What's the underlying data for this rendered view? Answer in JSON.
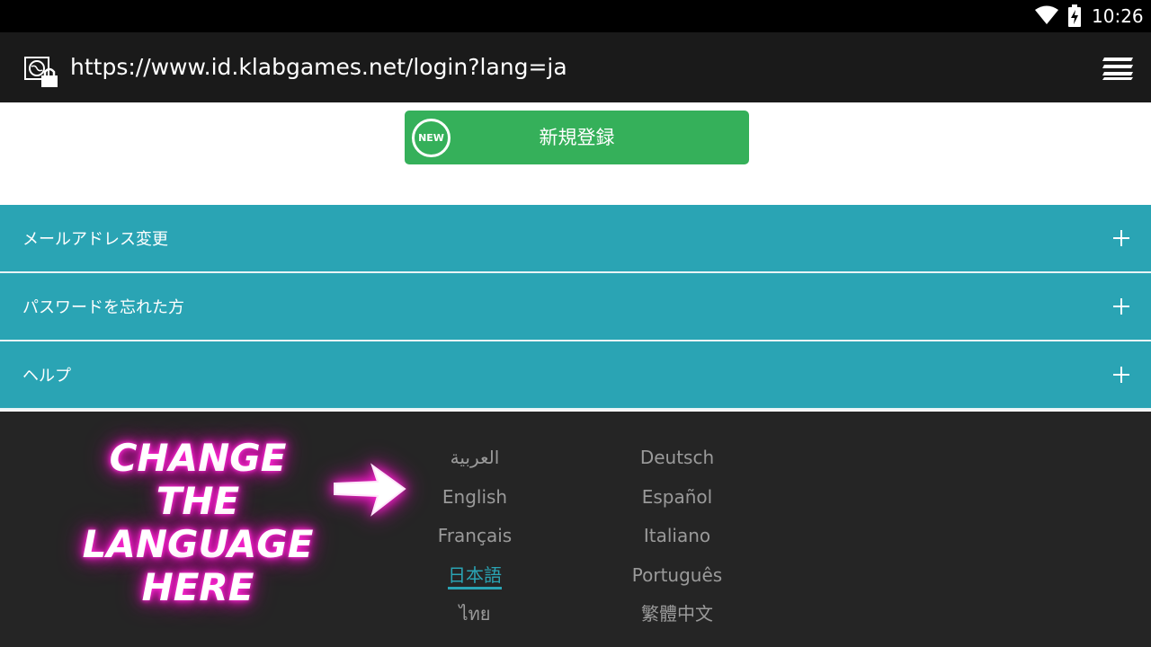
{
  "status_bar": {
    "time": "10:26"
  },
  "address_bar": {
    "url": "https://www.id.klabgames.net/login?lang=ja"
  },
  "register": {
    "badge": "NEW",
    "label": "新規登録"
  },
  "accordion": [
    {
      "label": "メールアドレス変更"
    },
    {
      "label": "パスワードを忘れた方"
    },
    {
      "label": "ヘルプ"
    }
  ],
  "languages": {
    "col1": [
      "العربية",
      "English",
      "Français",
      "日本語",
      "ไทย"
    ],
    "col2": [
      "Deutsch",
      "Español",
      "Italiano",
      "Português",
      "繁體中文"
    ],
    "selected": "日本語"
  },
  "annotation": {
    "line1": "CHANGE THE",
    "line2": "LANGUAGE",
    "line3": "HERE"
  },
  "colors": {
    "accent_teal": "#2aa4b4",
    "register_green": "#35b05a",
    "annotation_glow": "#ff2bd4"
  }
}
